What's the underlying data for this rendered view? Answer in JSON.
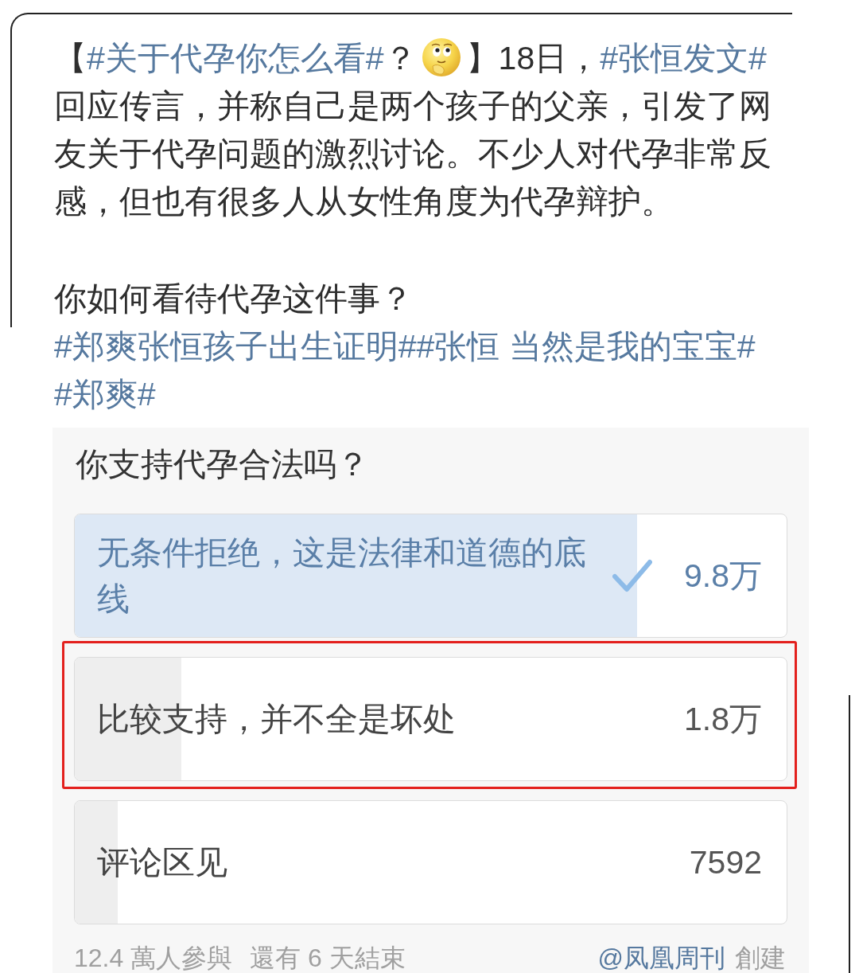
{
  "post": {
    "segments": [
      {
        "kind": "text",
        "text": "【"
      },
      {
        "kind": "hashtag",
        "text": "#关于代孕你怎么看#"
      },
      {
        "kind": "text",
        "text": "？"
      },
      {
        "kind": "emoji"
      },
      {
        "kind": "text",
        "text": "】18日，"
      },
      {
        "kind": "hashtag",
        "text": "#张恒发文#"
      },
      {
        "kind": "text",
        "text": "回应传言，并称自己是两个孩子的父亲，引发了网友关于代孕问题的激烈讨论。不少人对代孕非常反感，但也有很多人从女性角度为代孕辩护。"
      }
    ],
    "question": "你如何看待代孕这件事？",
    "hashtags": [
      "#郑爽张恒孩子出生证明#",
      "#张恒 当然是我的宝宝#",
      "#郑爽#"
    ]
  },
  "poll": {
    "title": "你支持代孕合法吗？",
    "options": [
      {
        "label": "无条件拒绝，这是法律和道德的底线",
        "count": "9.8万",
        "level": 0.79,
        "selected": true,
        "highlighted": false
      },
      {
        "label": "比较支持，并不全是坏处",
        "count": "1.8万",
        "level": 0.15,
        "selected": false,
        "highlighted": true
      },
      {
        "label": "评论区见",
        "count": "7592",
        "level": 0.06,
        "selected": false,
        "highlighted": false
      }
    ],
    "participants": "12.4 萬人參與",
    "time_left": "還有 6 天結束",
    "creator": "@凤凰周刊",
    "created_label": "創建"
  }
}
